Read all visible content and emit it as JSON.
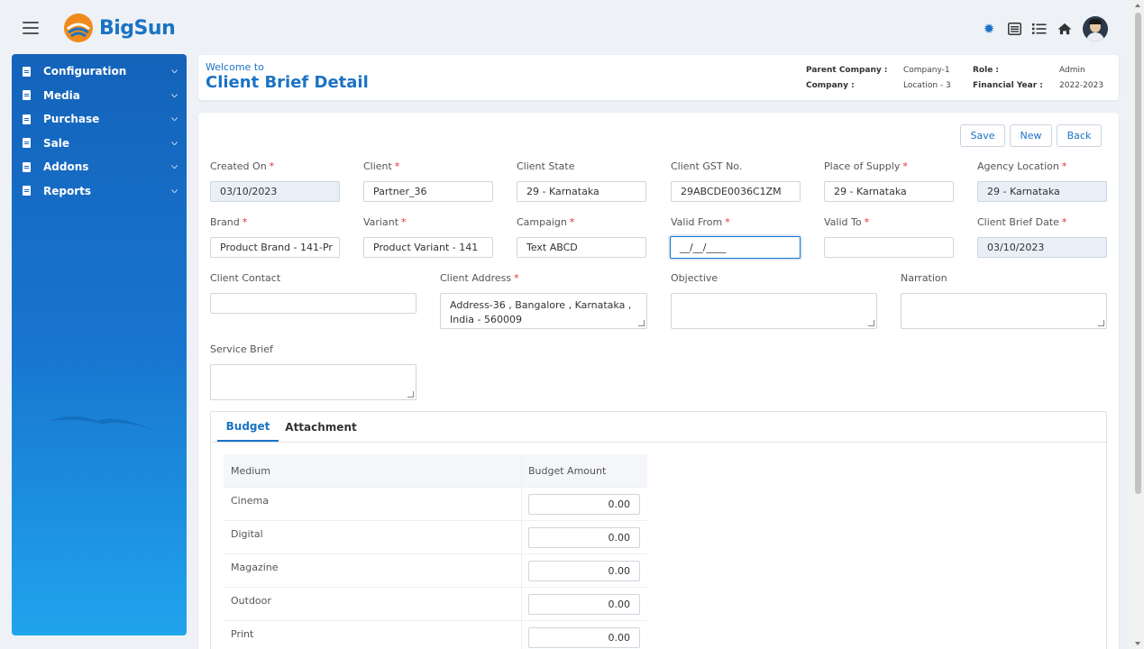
{
  "app": {
    "name": "BigSun"
  },
  "top_icons": [
    "gear-icon",
    "list-alt-icon",
    "list-icon",
    "home-icon",
    "avatar"
  ],
  "sidebar": {
    "items": [
      {
        "label": "Configuration"
      },
      {
        "label": "Media"
      },
      {
        "label": "Purchase"
      },
      {
        "label": "Sale"
      },
      {
        "label": "Addons"
      },
      {
        "label": "Reports"
      }
    ]
  },
  "header": {
    "welcome": "Welcome to",
    "title": "Client Brief Detail",
    "parent_company_label": "Parent Company :",
    "parent_company_value": "Company-1",
    "company_label": "Company :",
    "company_value": "Location - 3",
    "role_label": "Role :",
    "role_value": "Admin",
    "fy_label": "Financial Year :",
    "fy_value": "2022-2023"
  },
  "actions": {
    "save": "Save",
    "new": "New",
    "back": "Back"
  },
  "form": {
    "created_on": {
      "label": "Created On",
      "value": "03/10/2023"
    },
    "client": {
      "label": "Client",
      "value": "Partner_36"
    },
    "client_state": {
      "label": "Client State",
      "value": "29 - Karnataka"
    },
    "client_gst": {
      "label": "Client GST No.",
      "value": "29ABCDE0036C1ZM"
    },
    "place_of_supply": {
      "label": "Place of Supply",
      "value": "29 - Karnataka"
    },
    "agency_location": {
      "label": "Agency Location",
      "value": "29 - Karnataka"
    },
    "brand": {
      "label": "Brand",
      "value": "Product Brand - 141-Pr"
    },
    "variant": {
      "label": "Variant",
      "value": "Product Variant - 141"
    },
    "campaign": {
      "label": "Campaign",
      "value": "Text ABCD"
    },
    "valid_from": {
      "label": "Valid From",
      "value": "__/__/____"
    },
    "valid_to": {
      "label": "Valid To",
      "value": ""
    },
    "client_brief_date": {
      "label": "Client Brief Date",
      "value": "03/10/2023"
    },
    "client_contact": {
      "label": "Client Contact",
      "value": ""
    },
    "client_address": {
      "label": "Client Address",
      "line1": "Address-36 , Bangalore , Karnataka ,",
      "line2": "India - 560009"
    },
    "objective": {
      "label": "Objective",
      "value": ""
    },
    "narration": {
      "label": "Narration",
      "value": ""
    },
    "service_brief": {
      "label": "Service Brief",
      "value": ""
    },
    "required_mark": "*"
  },
  "tabs": [
    {
      "label": "Budget",
      "active": true
    },
    {
      "label": "Attachment",
      "active": false
    }
  ],
  "budget": {
    "headers": [
      "Medium",
      "Budget Amount"
    ],
    "rows": [
      {
        "medium": "Cinema",
        "amount": "0.00"
      },
      {
        "medium": "Digital",
        "amount": "0.00"
      },
      {
        "medium": "Magazine",
        "amount": "0.00"
      },
      {
        "medium": "Outdoor",
        "amount": "0.00"
      },
      {
        "medium": "Print",
        "amount": "0.00"
      }
    ]
  },
  "colors": {
    "brand": "#1b73c4",
    "required": "#e0303a",
    "readonly": "#e9eff6"
  }
}
